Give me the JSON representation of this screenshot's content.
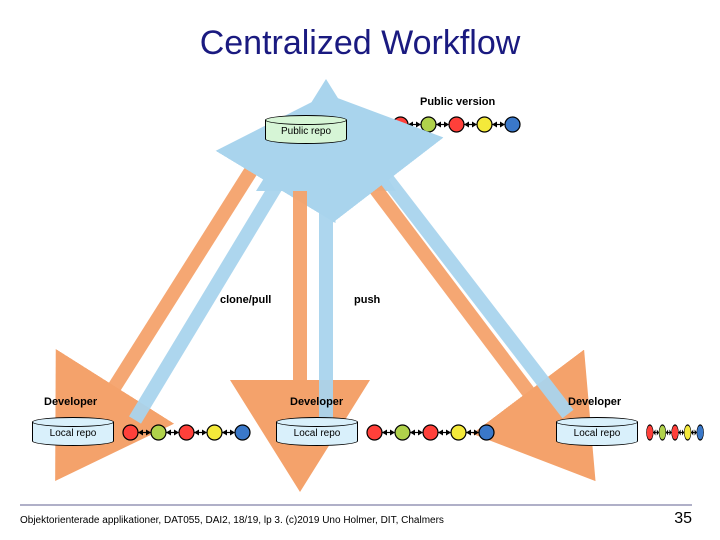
{
  "title": "Centralized Workflow",
  "labels": {
    "public_version": "Public version",
    "clone_pull": "clone/pull",
    "push": "push",
    "developer": "Developer",
    "public_repo": "Public repo",
    "local_repo": "Local repo"
  },
  "commit_colors": {
    "public": [
      "#ff403a",
      "#b0d24b",
      "#ff403a",
      "#f4e93a",
      "#3a78c9"
    ],
    "dev_left": [
      "#ff403a",
      "#b0d24b",
      "#ff403a",
      "#f4e93a",
      "#3a78c9"
    ],
    "dev_mid": [
      "#ff403a",
      "#b0d24b",
      "#ff403a",
      "#f4e93a",
      "#3a78c9"
    ],
    "dev_right": [
      "#ff403a",
      "#b0d24b",
      "#ff403a",
      "#f4e93a",
      "#3a78c9"
    ]
  },
  "footer": "Objektorienterade applikationer, DAT055, DAI2, 18/19, lp 3. (c)2019 Uno Holmer, DIT, Chalmers",
  "page": "35"
}
